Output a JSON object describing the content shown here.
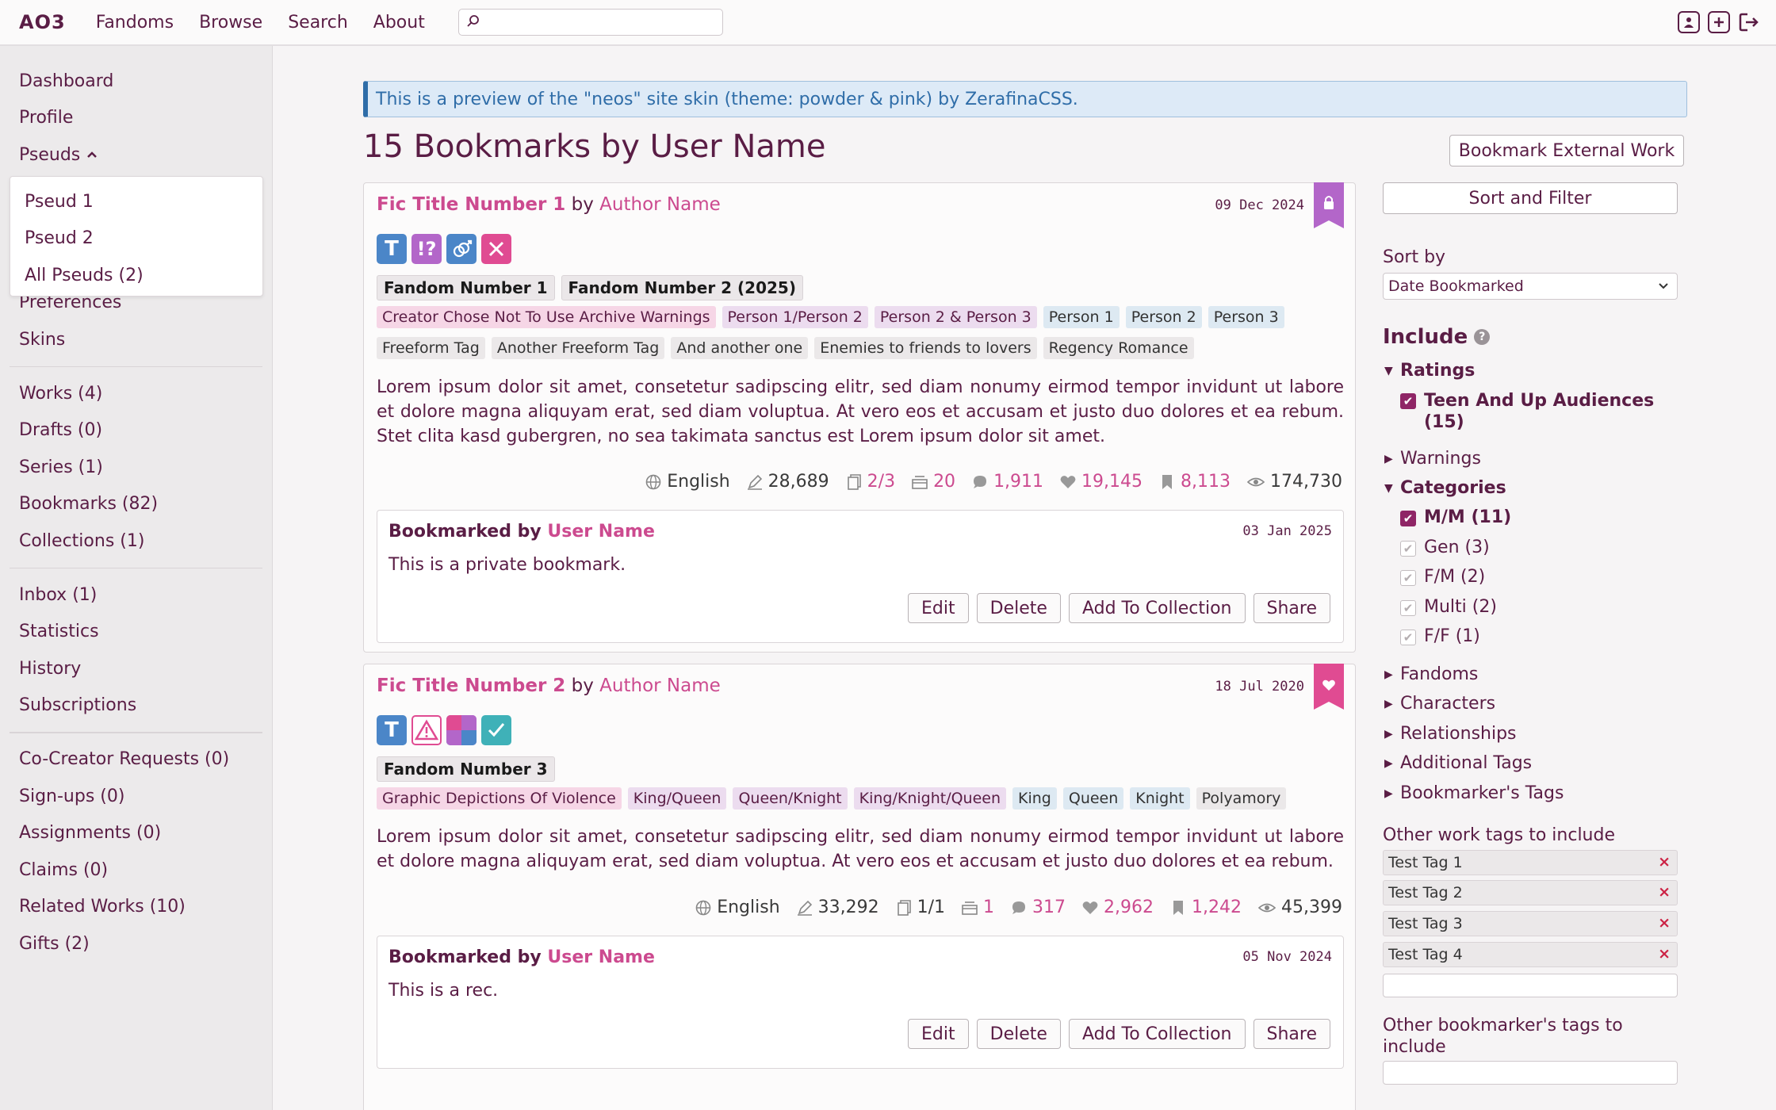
{
  "nav": {
    "logo": "AO3",
    "links": [
      "Fandoms",
      "Browse",
      "Search",
      "About"
    ],
    "search_value": ""
  },
  "sidebar": {
    "dashboard": "Dashboard",
    "profile": "Profile",
    "pseuds": "Pseuds",
    "pseud_menu": [
      "Pseud 1",
      "Pseud 2",
      "All Pseuds (2)"
    ],
    "preferences": "Preferences",
    "skins": "Skins",
    "works": "Works (4)",
    "drafts": "Drafts (0)",
    "series": "Series (1)",
    "bookmarks": "Bookmarks (82)",
    "collections": "Collections (1)",
    "inbox": "Inbox (1)",
    "statistics": "Statistics",
    "history": "History",
    "subscriptions": "Subscriptions",
    "cocreator": "Co-Creator Requests (0)",
    "signups": "Sign-ups (0)",
    "assignments": "Assignments (0)",
    "claims": "Claims (0)",
    "related": "Related Works (10)",
    "gifts": "Gifts (2)"
  },
  "banner": "This is a preview of the \"neos\" site skin (theme: powder & pink) by ZerafinaCSS.",
  "page_title": "15 Bookmarks by User Name",
  "external_btn": "Bookmark External Work",
  "by": "by",
  "works": [
    {
      "title": "Fic Title Number 1",
      "author": "Author Name",
      "date": "09 Dec 2024",
      "fandoms": [
        "Fandom Number 1",
        "Fandom Number 2 (2025)"
      ],
      "tags_row1": [
        "Creator Chose Not To Use Archive Warnings",
        "Person 1/Person 2",
        "Person 2 & Person 3",
        "Person 1",
        "Person 2",
        "Person 3"
      ],
      "tags_row2": [
        "Freeform Tag",
        "Another Freeform Tag",
        "And another one",
        "Enemies to friends to lovers",
        "Regency Romance"
      ],
      "summary": "Lorem ipsum dolor sit amet, consetetur sadipscing elitr, sed diam nonumy eirmod tempor invidunt ut labore et dolore magna aliquyam erat, sed diam voluptua. At vero eos et accusam et justo duo dolores et ea rebum. Stet clita kasd gubergren, no sea takimata sanctus est Lorem ipsum dolor sit amet.",
      "language": "English",
      "words": "28,689",
      "chapters": "2/3",
      "collections": "20",
      "comments": "1,911",
      "kudos": "19,145",
      "bookmarks": "8,113",
      "hits": "174,730",
      "bm_label": "Bookmarked by",
      "bm_user": "User Name",
      "bm_date": "03 Jan 2025",
      "bm_note": "This is a private bookmark."
    },
    {
      "title": "Fic Title Number 2",
      "author": "Author Name",
      "date": "18 Jul 2020",
      "fandoms": [
        "Fandom Number 3"
      ],
      "tags_row1": [
        "Graphic Depictions Of Violence",
        "King/Queen",
        "Queen/Knight",
        "King/Knight/Queen",
        "King",
        "Queen",
        "Knight",
        "Polyamory"
      ],
      "summary": "Lorem ipsum dolor sit amet, consetetur sadipscing elitr, sed diam nonumy eirmod tempor invidunt ut labore et dolore magna aliquyam erat, sed diam voluptua. At vero eos et accusam et justo duo dolores et ea rebum.",
      "language": "English",
      "words": "33,292",
      "chapters": "1/1",
      "collections": "1",
      "comments": "317",
      "kudos": "2,962",
      "bookmarks": "1,242",
      "hits": "45,399",
      "bm_label": "Bookmarked by",
      "bm_user": "User Name",
      "bm_date": "05 Nov 2024",
      "bm_note": "This is a rec."
    }
  ],
  "bm_buttons": [
    "Edit",
    "Delete",
    "Add To Collection",
    "Share"
  ],
  "filters": {
    "sort_filter": "Sort and Filter",
    "sort_by": "Sort by",
    "sort_value": "Date Bookmarked",
    "include": "Include",
    "ratings": "Ratings",
    "rating_teen": "Teen And Up Audiences",
    "rating_teen_count": "(15)",
    "warnings": "Warnings",
    "categories": "Categories",
    "cat_mm": "M/M (11)",
    "cat_gen": "Gen (3)",
    "cat_fm": "F/M (2)",
    "cat_multi": "Multi (2)",
    "cat_ff": "F/F (1)",
    "fandoms": "Fandoms",
    "characters": "Characters",
    "relationships": "Relationships",
    "additional": "Additional Tags",
    "bookmarker_tags": "Bookmarker's Tags",
    "other_work_tags": "Other work tags to include",
    "test_tags": [
      "Test Tag 1",
      "Test Tag 2",
      "Test Tag 3",
      "Test Tag 4"
    ],
    "other_bm_tags_1": "Other bookmarker's tags to",
    "other_bm_tags_2": "include"
  },
  "colors": {
    "accent": "#cc4a8f",
    "text": "#5a1d45",
    "banner": "#2f6da8"
  }
}
